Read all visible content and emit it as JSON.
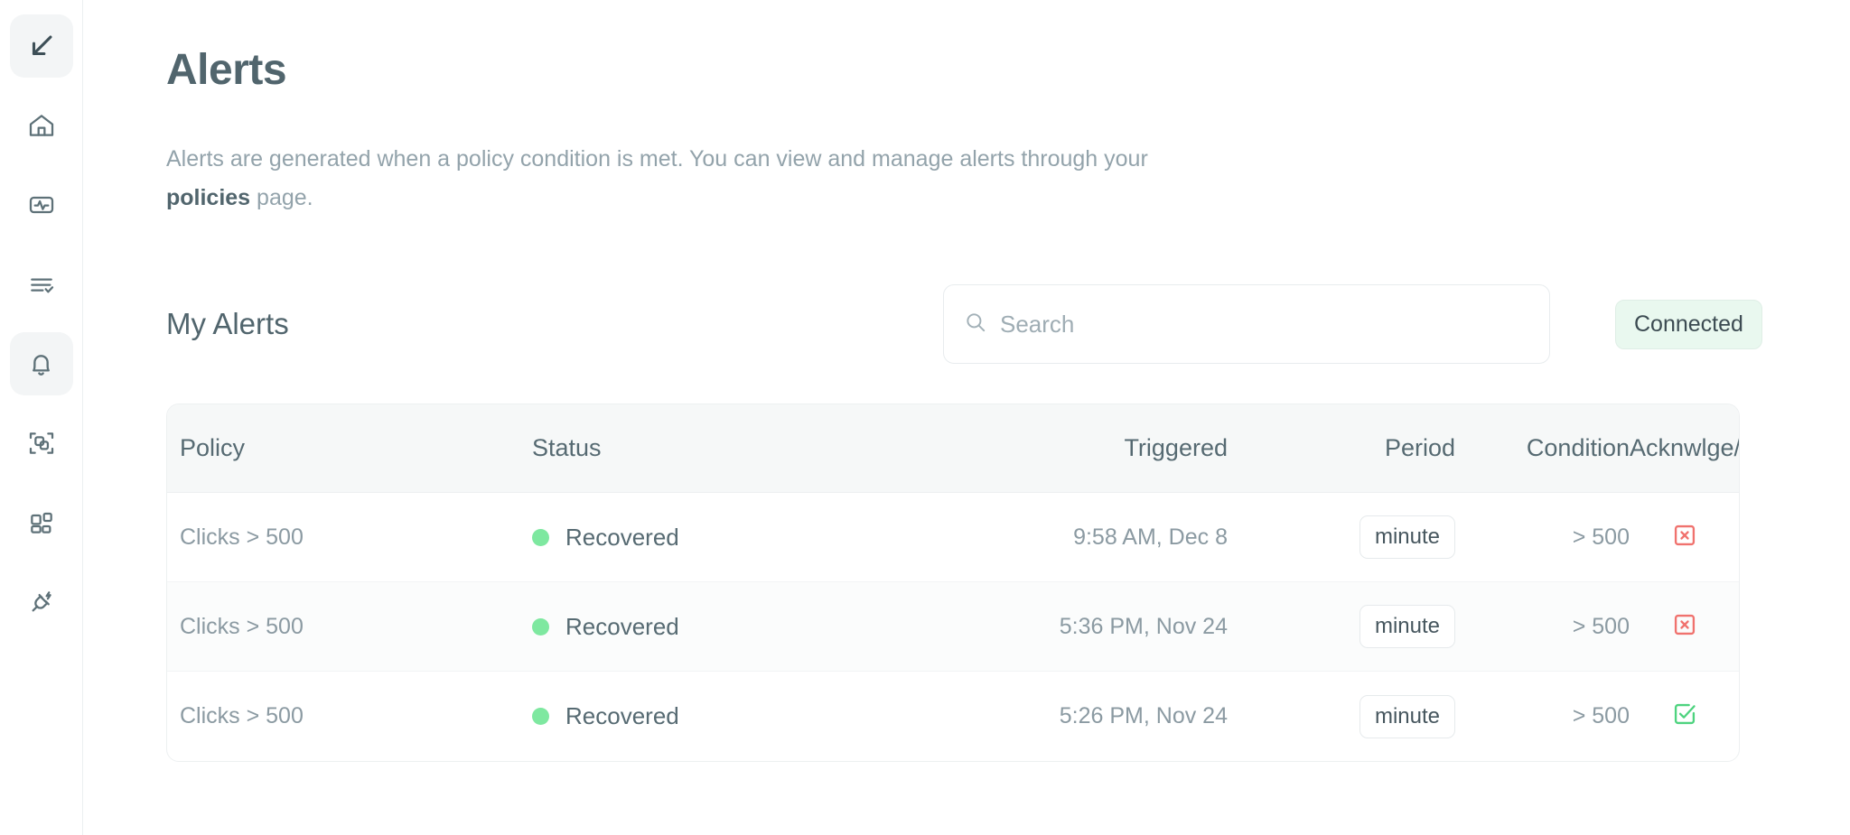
{
  "sidebar": {
    "items": [
      {
        "icon": "collapse-arrow-icon",
        "name": "collapse-toggle",
        "active": true
      },
      {
        "icon": "home-icon",
        "name": "home",
        "active": false
      },
      {
        "icon": "activity-pulse-icon",
        "name": "activity",
        "active": false
      },
      {
        "icon": "checklist-icon",
        "name": "tasks",
        "active": false
      },
      {
        "icon": "bell-icon",
        "name": "alerts",
        "active": true
      },
      {
        "icon": "group-frame-icon",
        "name": "groups",
        "active": false
      },
      {
        "icon": "blocks-icon",
        "name": "dashboards",
        "active": false
      },
      {
        "icon": "plug-icon",
        "name": "integrations",
        "active": false
      }
    ]
  },
  "page": {
    "title": "Alerts",
    "description_before": "Alerts are generated when a policy condition is met. You can view and manage alerts through your ",
    "description_link": "policies",
    "description_after": " page."
  },
  "toolbar": {
    "section_title": "My Alerts",
    "search_placeholder": "Search",
    "search_value": "",
    "search_icon": "search-icon",
    "connection_badge": "Connected"
  },
  "table": {
    "columns": [
      "Policy",
      "Status",
      "Triggered",
      "Period",
      "Condition",
      "Acknwlge/d"
    ],
    "rows": [
      {
        "policy": "Clicks > 500",
        "status": "Recovered",
        "status_color": "#7ee8a0",
        "triggered": "9:58 AM, Dec 8",
        "period": "minute",
        "condition": "> 500",
        "acknowledged": false,
        "ack_icon": "checkbox-x-icon"
      },
      {
        "policy": "Clicks > 500",
        "status": "Recovered",
        "status_color": "#7ee8a0",
        "triggered": "5:36 PM, Nov 24",
        "period": "minute",
        "condition": "> 500",
        "acknowledged": false,
        "ack_icon": "checkbox-x-icon"
      },
      {
        "policy": "Clicks > 500",
        "status": "Recovered",
        "status_color": "#7ee8a0",
        "triggered": "5:26 PM, Nov 24",
        "period": "minute",
        "condition": "> 500",
        "acknowledged": true,
        "ack_icon": "checkbox-check-icon"
      }
    ]
  },
  "colors": {
    "heading": "#51656d",
    "body_text": "#93a3ab",
    "status_green": "#7ee8a0",
    "badge_bg": "#e9f8ef",
    "ack_red": "#f0726e",
    "ack_green": "#4ed37f",
    "table_header_bg": "#f6f8f8"
  }
}
